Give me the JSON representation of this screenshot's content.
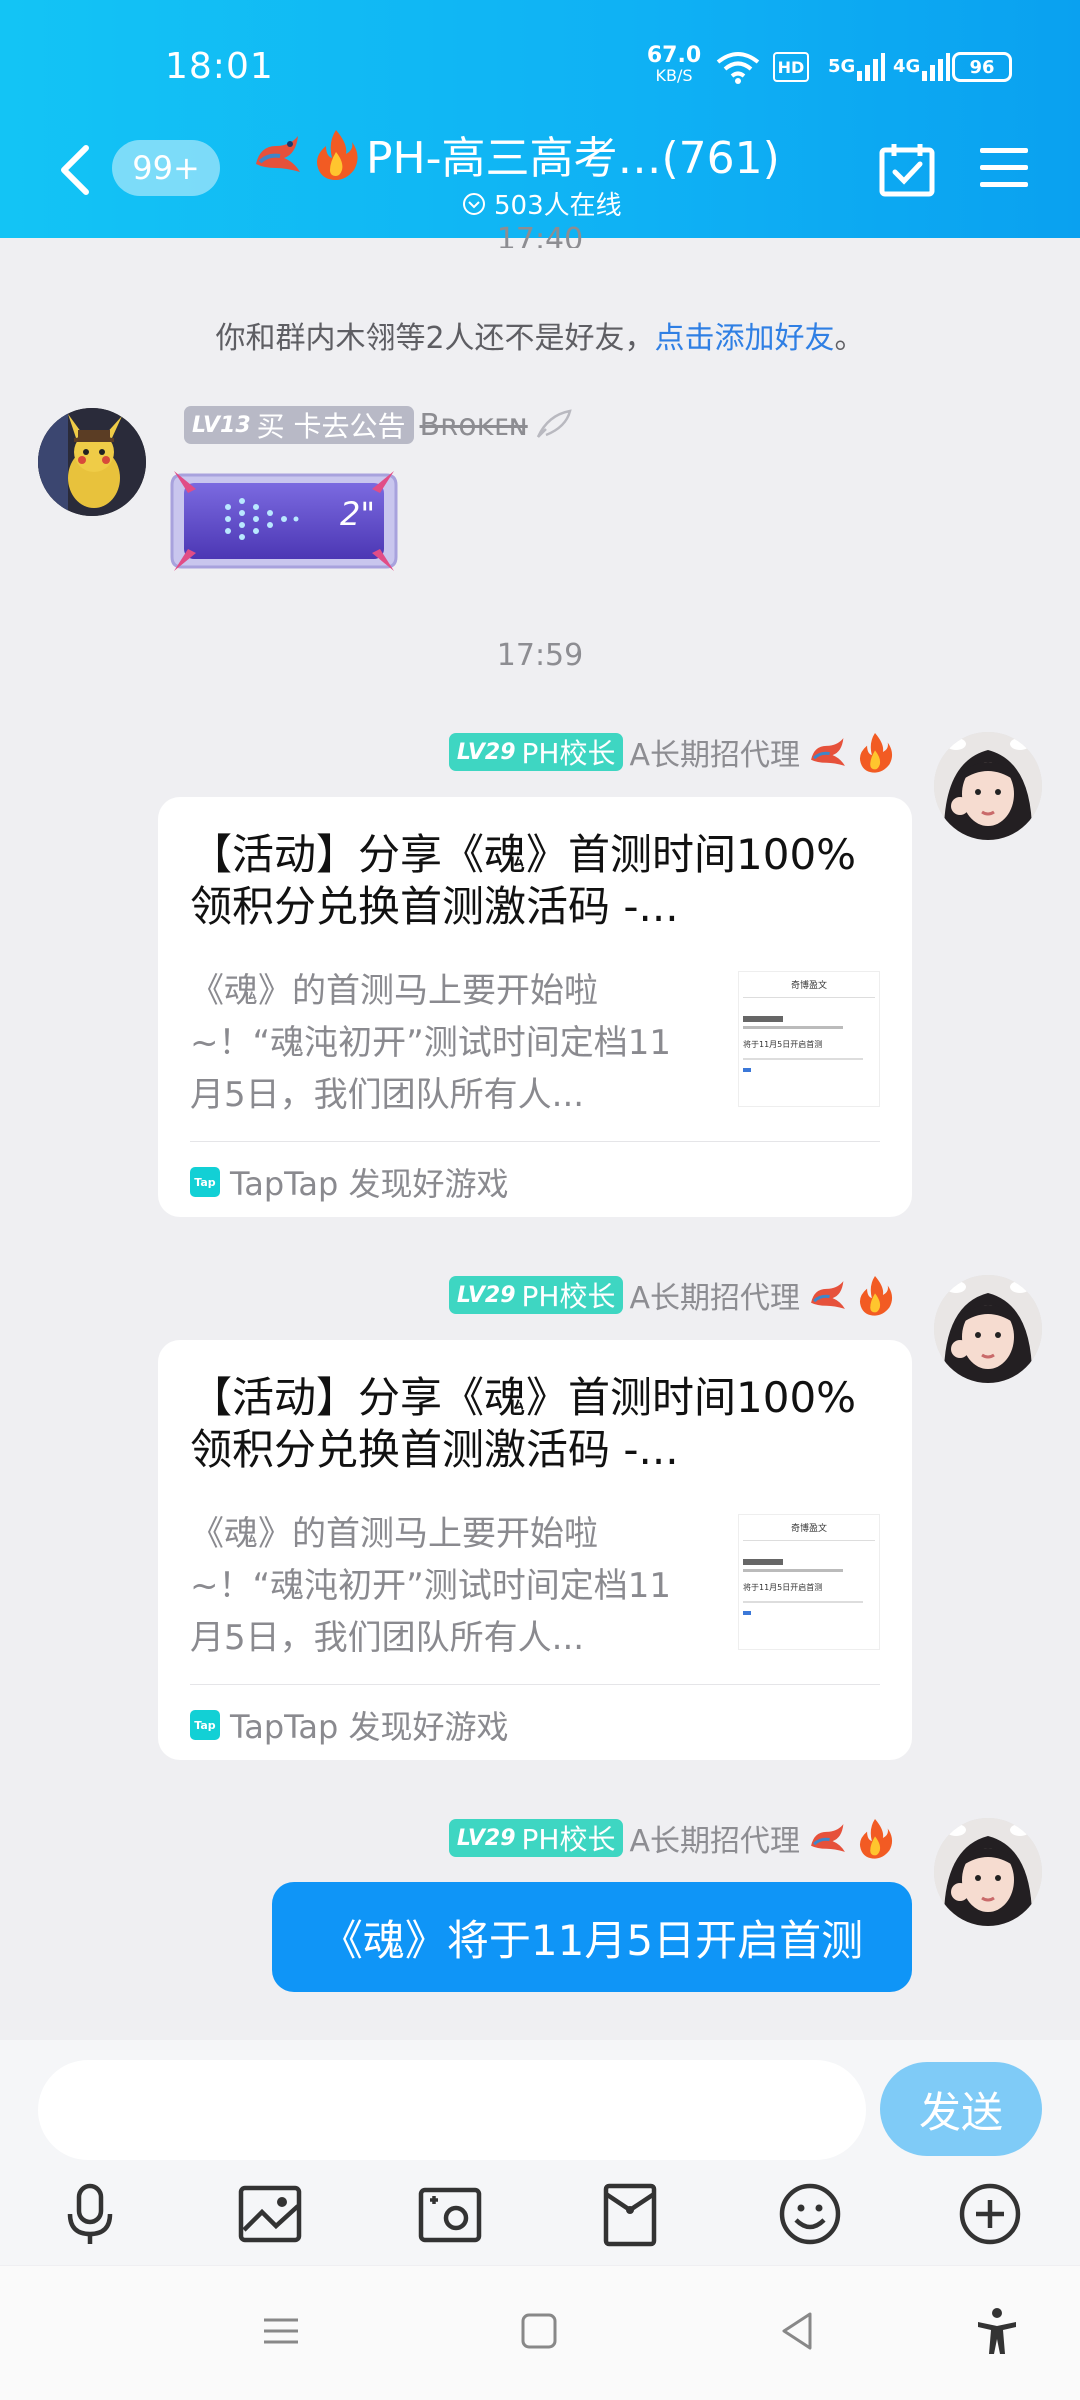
{
  "status_bar": {
    "time": "18:01",
    "net_speed_value": "67.0",
    "net_speed_unit": "KB/S",
    "hd_label": "HD",
    "sig5g_label": "5G",
    "sig4g_label": "4G",
    "battery": "96"
  },
  "header": {
    "unread_badge": "99+",
    "group_title": "PH-高三高考…(761)",
    "online_count": "503人在线"
  },
  "chat": {
    "partial_time": "17:40",
    "friend_tip": {
      "prefix": "你和群内木翎等2人还不是好友，",
      "link": "点击添加好友",
      "suffix": "。"
    },
    "time_label": "17:59",
    "messages": [
      {
        "level": "LV13",
        "title_badge": "买 卡去公告",
        "name": "Bʀᴏᴋᴇɴ",
        "voice_duration": "2\""
      },
      {
        "level": "LV29",
        "title_badge": "PH校长",
        "name": "A长期招代理",
        "card": {
          "title": "【活动】分享《魂》首测时间100%领积分兑换首测激活码 -...",
          "desc": "《魂》的首测马上要开始啦~！“魂沌初开”测试时间定档11月5日，我们团队所有人...",
          "thumb_title": "奇博盈文",
          "thumb_line": "将于11月5日开启首测",
          "source": "TapTap 发现好游戏",
          "logo": "Tap"
        }
      },
      {
        "level": "LV29",
        "title_badge": "PH校长",
        "name": "A长期招代理",
        "card": {
          "title": "【活动】分享《魂》首测时间100%领积分兑换首测激活码 -...",
          "desc": "《魂》的首测马上要开始啦~！“魂沌初开”测试时间定档11月5日，我们团队所有人...",
          "thumb_title": "奇博盈文",
          "thumb_line": "将于11月5日开启首测",
          "source": "TapTap 发现好游戏",
          "logo": "Tap"
        }
      },
      {
        "level": "LV29",
        "title_badge": "PH校长",
        "name": "A长期招代理",
        "text": "《魂》将于11月5日开启首测"
      }
    ]
  },
  "input": {
    "placeholder": "",
    "send_label": "发送"
  },
  "icons": {
    "back": "back-arrow-icon",
    "calendar": "calendar-check-icon",
    "menu": "hamburger-menu-icon",
    "tools": [
      "microphone-icon",
      "image-icon",
      "camera-icon",
      "red-packet-icon",
      "emoji-icon",
      "plus-icon"
    ],
    "nav": [
      "menu-nav-icon",
      "home-nav-icon",
      "back-nav-icon",
      "accessibility-icon"
    ]
  },
  "colors": {
    "header_start": "#13c4f5",
    "header_end": "#0aa1f0",
    "bubble": "#0f95f7",
    "send_button": "#7fcbf7",
    "link": "#2f7fe4",
    "level_teal": "#3ed6c2",
    "level_gray": "#b8b9c6"
  }
}
